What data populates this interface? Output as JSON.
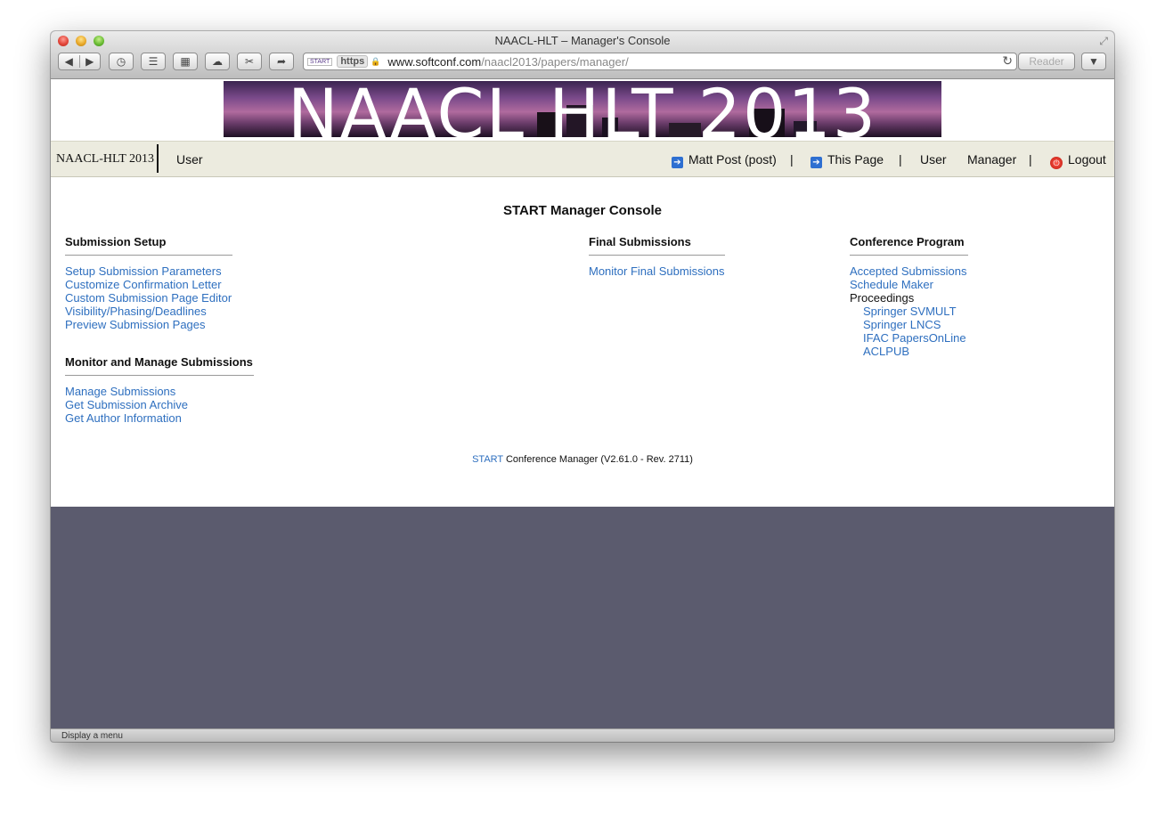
{
  "window": {
    "title": "NAACL-HLT – Manager's Console"
  },
  "toolbar": {
    "back_icon": "back-arrow",
    "forward_icon": "forward-arrow",
    "reader_label": "Reader"
  },
  "address_bar": {
    "favicon_text": "START",
    "https_label": "https",
    "host": "www.softconf.com",
    "path": "/naacl2013/papers/manager/"
  },
  "banner": {
    "text": "NAACL HLT 2013"
  },
  "nav": {
    "conference_name": "NAACL-HLT 2013",
    "user_link": "User",
    "account": "Matt Post (post)",
    "this_page": "This Page",
    "separator": "|",
    "user_right": "User",
    "manager": "Manager",
    "logout": "Logout"
  },
  "main": {
    "title": "START Manager Console",
    "sections": {
      "submission_setup": {
        "title": "Submission Setup",
        "links": [
          "Setup Submission Parameters",
          "Customize Confirmation Letter",
          "Custom Submission Page Editor",
          "Visibility/Phasing/Deadlines",
          "Preview Submission Pages"
        ]
      },
      "monitor_manage": {
        "title": "Monitor and Manage Submissions",
        "links": [
          "Manage Submissions",
          "Get Submission Archive",
          "Get Author Information"
        ]
      },
      "final_submissions": {
        "title": "Final Submissions",
        "links": [
          "Monitor Final Submissions"
        ]
      },
      "conference_program": {
        "title": "Conference Program",
        "links": [
          "Accepted Submissions",
          "Schedule Maker"
        ],
        "proceedings_label": "Proceedings",
        "proceedings_links": [
          "Springer SVMULT",
          "Springer LNCS",
          "IFAC PapersOnLine",
          "ACLPUB"
        ]
      }
    }
  },
  "footer": {
    "start_link": "START",
    "text": "Conference Manager (V2.61.0 - Rev. 2711)"
  },
  "status_bar": {
    "text": "Display a menu"
  },
  "colors": {
    "link": "#2e6fbf",
    "nav_background": "#ecebdf",
    "page_background_below": "#5b5b6e"
  }
}
